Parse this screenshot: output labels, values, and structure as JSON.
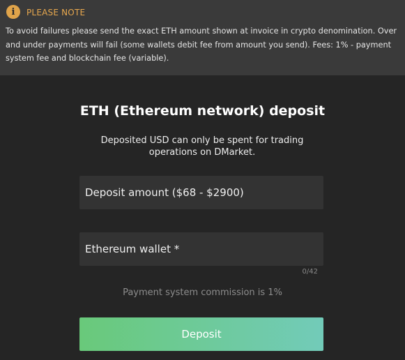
{
  "notice": {
    "icon": "info-icon",
    "icon_glyph": "i",
    "title": "PLEASE NOTE",
    "text": "To avoid failures please send the exact ETH amount shown at invoice in crypto denomination. Over and under payments will fail (some wallets debit fee from amount you send). Fees: 1% - payment system fee and blockchain fee (variable).",
    "accent_color": "#e8a84e"
  },
  "title": "ETH (Ethereum network) deposit",
  "subtitle": "Deposited USD can only be spent for trading operations on DMarket.",
  "form": {
    "amount_placeholder": "Deposit amount ($68 - $2900)",
    "amount_value": "",
    "wallet_placeholder": "Ethereum wallet *",
    "wallet_value": "",
    "wallet_counter": "0/42"
  },
  "commission": "Payment system commission is 1%",
  "deposit_button": "Deposit",
  "colors": {
    "background": "#252525",
    "notice_background": "#3a3a3a",
    "button_gradient_start": "#69c97a",
    "button_gradient_end": "#72cbb9"
  }
}
